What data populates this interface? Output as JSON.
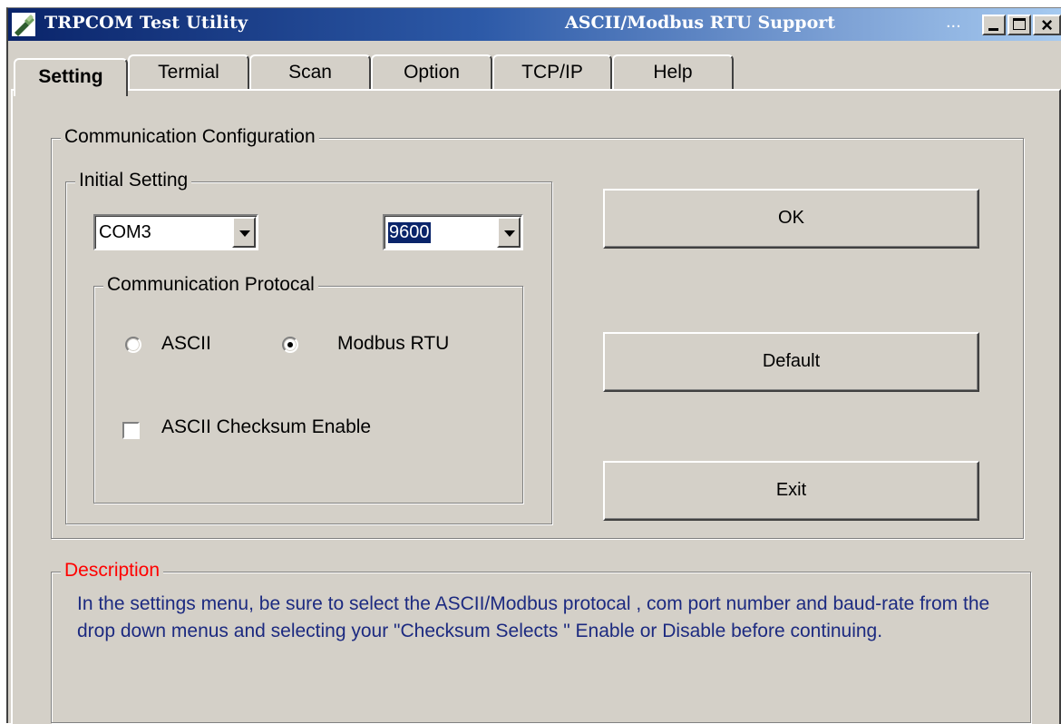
{
  "window": {
    "title": "TRPCOM Test Utility",
    "subtitle": "ASCII/Modbus RTU Support",
    "ellipsis": "...",
    "close_symbol": "×",
    "accent_color": "#0a246a"
  },
  "tabs": [
    {
      "label": "Setting",
      "active": true
    },
    {
      "label": "Termial",
      "active": false
    },
    {
      "label": "Scan",
      "active": false
    },
    {
      "label": "Option",
      "active": false
    },
    {
      "label": "TCP/IP",
      "active": false
    },
    {
      "label": "Help",
      "active": false
    }
  ],
  "communication_configuration": {
    "title": "Communication Configuration",
    "initial_setting": {
      "title": "Initial Setting",
      "com_port": "COM3",
      "baud_rate": "9600"
    },
    "protocol": {
      "title": "Communication Protocal",
      "ascii_label": "ASCII",
      "ascii_selected": false,
      "modbus_label": "Modbus RTU",
      "modbus_selected": true,
      "checksum_label": "ASCII Checksum Enable",
      "checksum_checked": false
    },
    "buttons": {
      "ok": "OK",
      "default": "Default",
      "exit": "Exit"
    }
  },
  "description": {
    "title": "Description",
    "title_color": "#ff0000",
    "text": "In the settings menu, be sure to select the ASCII/Modbus protocal , com port number and baud-rate from the drop down menus and selecting your \"Checksum Selects \" Enable or Disable before continuing."
  }
}
